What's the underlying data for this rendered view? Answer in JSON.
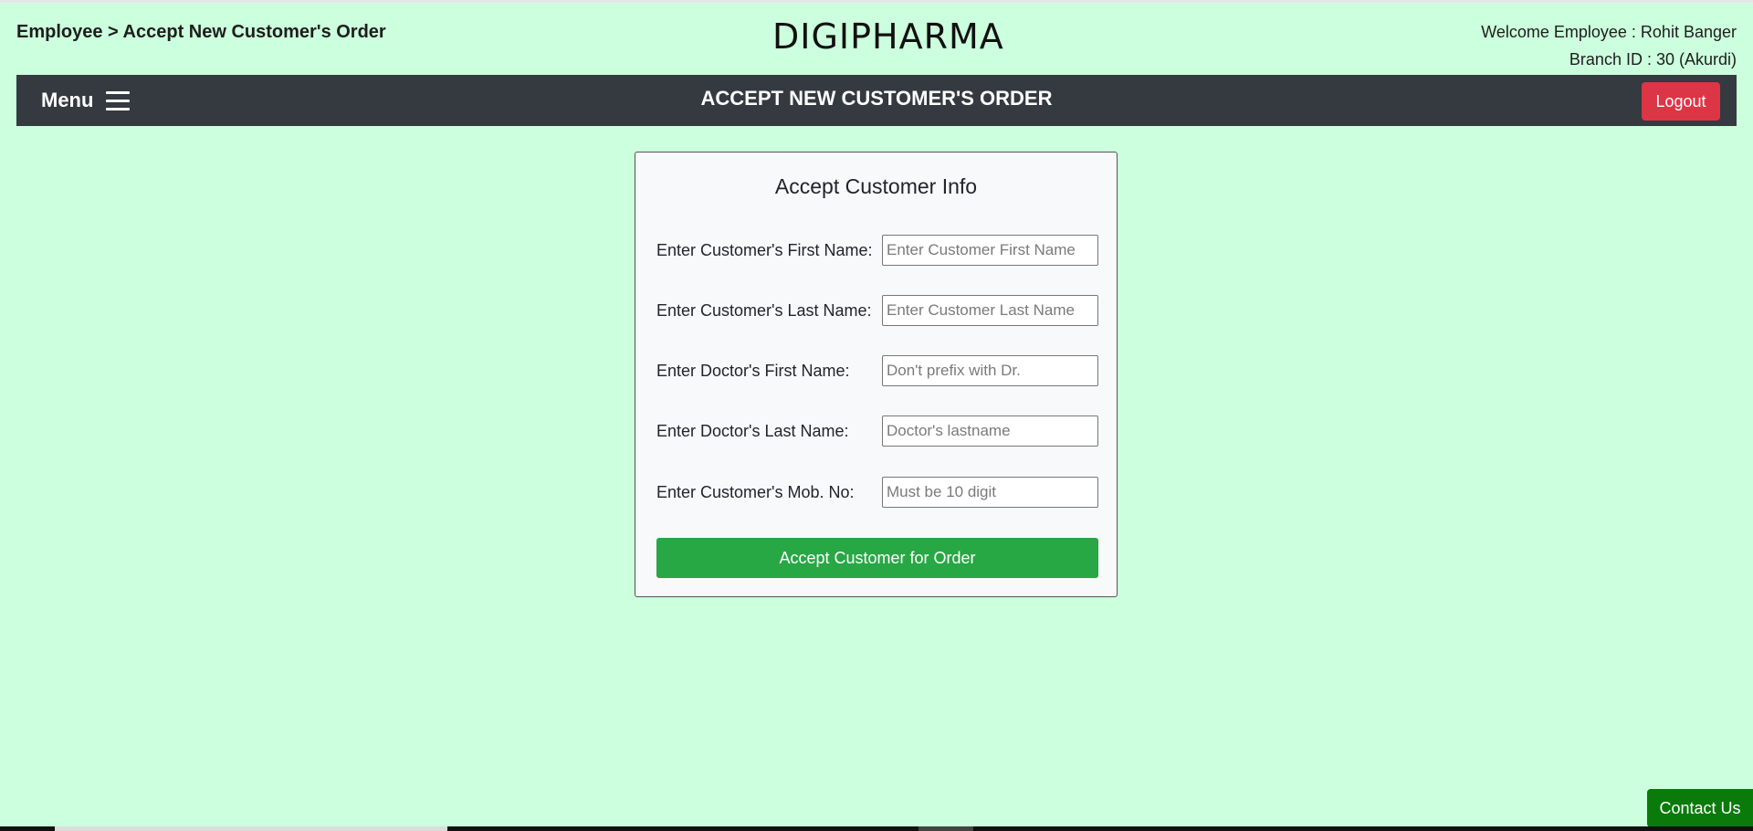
{
  "header": {
    "breadcrumb": "Employee > Accept New Customer's Order",
    "brand": "DIGIPHARMA",
    "welcome_line": "Welcome Employee : Rohit Banger",
    "branch_line": "Branch ID : 30 (Akurdi)"
  },
  "navbar": {
    "menu_label": "Menu",
    "title": "ACCEPT NEW CUSTOMER'S ORDER",
    "logout_label": "Logout"
  },
  "form": {
    "title": "Accept Customer Info",
    "fields": [
      {
        "label": "Enter Customer's First Name:",
        "placeholder": "Enter Customer First Name",
        "value": ""
      },
      {
        "label": "Enter Customer's Last Name:",
        "placeholder": "Enter Customer Last Name",
        "value": ""
      },
      {
        "label": "Enter Doctor's First Name:",
        "placeholder": "Don't prefix with Dr.",
        "value": ""
      },
      {
        "label": "Enter Doctor's Last Name:",
        "placeholder": "Doctor's lastname",
        "value": ""
      },
      {
        "label": "Enter Customer's Mob. No:",
        "placeholder": "Must be 10 digit",
        "value": ""
      }
    ],
    "submit_label": "Accept Customer for Order"
  },
  "footer": {
    "contact_label": "Contact Us"
  },
  "colors": {
    "page_background": "#ccffdd",
    "navbar": "#343a40",
    "logout": "#dc3545",
    "submit": "#28a745",
    "contact": "#0a7a0a"
  },
  "icons": {
    "menu": "hamburger-icon"
  }
}
